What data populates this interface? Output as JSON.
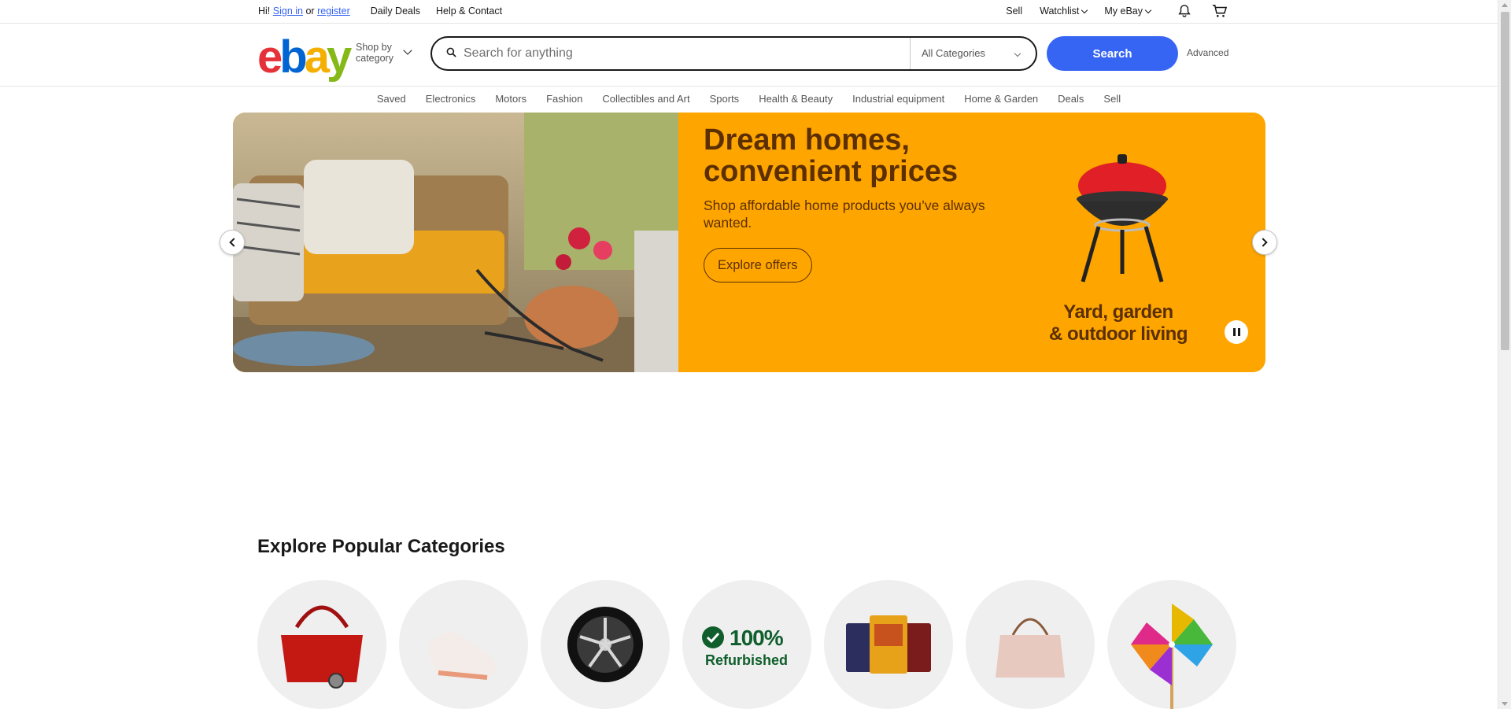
{
  "topbar": {
    "greeting": "Hi!",
    "sign_in": "Sign in",
    "or": "or",
    "register": "register",
    "daily_deals": "Daily Deals",
    "help_contact": "Help & Contact",
    "sell": "Sell",
    "watchlist": "Watchlist",
    "my_ebay": "My eBay"
  },
  "header": {
    "logo": {
      "e": "e",
      "b": "b",
      "a": "a",
      "y": "y"
    },
    "shop_by_line1": "Shop by",
    "shop_by_line2": "category",
    "search_placeholder": "Search for anything",
    "category_select": "All Categories",
    "search_button": "Search",
    "advanced": "Advanced"
  },
  "nav": {
    "items": [
      "Saved",
      "Electronics",
      "Motors",
      "Fashion",
      "Collectibles and Art",
      "Sports",
      "Health & Beauty",
      "Industrial equipment",
      "Home & Garden",
      "Deals",
      "Sell"
    ]
  },
  "banner": {
    "title": "Dream homes, convenient prices",
    "subtitle": "Shop affordable home products you’ve always wanted.",
    "cta": "Explore offers",
    "caption_line1": "Yard, garden",
    "caption_line2": "& outdoor living"
  },
  "categories": {
    "heading": "Explore Popular Categories",
    "refurbished_pct": "100%",
    "refurbished_label": "Refurbished"
  },
  "colors": {
    "accent": "#3665f3",
    "banner_bg": "#fea500",
    "banner_text": "#5b2f00",
    "refurbished_green": "#0f5e2c"
  }
}
